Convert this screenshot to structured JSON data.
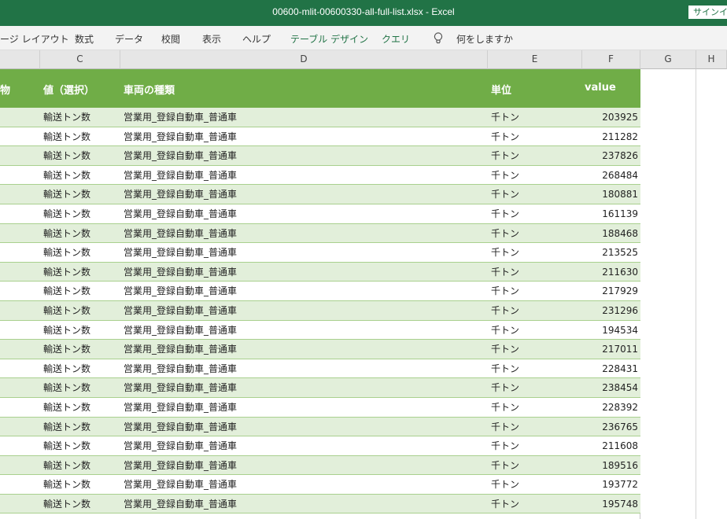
{
  "window": {
    "title": "00600-mlit-00600330-all-full-list.xlsx  -  Excel",
    "signin_label": "サインイン"
  },
  "ribbon": {
    "tabs": [
      {
        "label": "ージ レイアウト"
      },
      {
        "label": "数式"
      },
      {
        "label": "データ"
      },
      {
        "label": "校閲"
      },
      {
        "label": "表示"
      },
      {
        "label": "ヘルプ"
      },
      {
        "label": "テーブル デザイン"
      },
      {
        "label": "クエリ"
      }
    ],
    "tell_me": "何をしますか",
    "tell_me_icon": "lightbulb-icon"
  },
  "columns": [
    "C",
    "D",
    "E",
    "F",
    "G",
    "H"
  ],
  "table": {
    "headers": {
      "b": "物",
      "c": "値（選択）",
      "d": "車両の種類",
      "e": "単位",
      "f": "value"
    },
    "rows": [
      {
        "c": "輸送トン数",
        "d": "営業用_登録自動車_普通車",
        "e": "千トン",
        "f": "203925"
      },
      {
        "c": "輸送トン数",
        "d": "営業用_登録自動車_普通車",
        "e": "千トン",
        "f": "211282"
      },
      {
        "c": "輸送トン数",
        "d": "営業用_登録自動車_普通車",
        "e": "千トン",
        "f": "237826"
      },
      {
        "c": "輸送トン数",
        "d": "営業用_登録自動車_普通車",
        "e": "千トン",
        "f": "268484"
      },
      {
        "c": "輸送トン数",
        "d": "営業用_登録自動車_普通車",
        "e": "千トン",
        "f": "180881"
      },
      {
        "c": "輸送トン数",
        "d": "営業用_登録自動車_普通車",
        "e": "千トン",
        "f": "161139"
      },
      {
        "c": "輸送トン数",
        "d": "営業用_登録自動車_普通車",
        "e": "千トン",
        "f": "188468"
      },
      {
        "c": "輸送トン数",
        "d": "営業用_登録自動車_普通車",
        "e": "千トン",
        "f": "213525"
      },
      {
        "c": "輸送トン数",
        "d": "営業用_登録自動車_普通車",
        "e": "千トン",
        "f": "211630"
      },
      {
        "c": "輸送トン数",
        "d": "営業用_登録自動車_普通車",
        "e": "千トン",
        "f": "217929"
      },
      {
        "c": "輸送トン数",
        "d": "営業用_登録自動車_普通車",
        "e": "千トン",
        "f": "231296"
      },
      {
        "c": "輸送トン数",
        "d": "営業用_登録自動車_普通車",
        "e": "千トン",
        "f": "194534"
      },
      {
        "c": "輸送トン数",
        "d": "営業用_登録自動車_普通車",
        "e": "千トン",
        "f": "217011"
      },
      {
        "c": "輸送トン数",
        "d": "営業用_登録自動車_普通車",
        "e": "千トン",
        "f": "228431"
      },
      {
        "c": "輸送トン数",
        "d": "営業用_登録自動車_普通車",
        "e": "千トン",
        "f": "238454"
      },
      {
        "c": "輸送トン数",
        "d": "営業用_登録自動車_普通車",
        "e": "千トン",
        "f": "228392"
      },
      {
        "c": "輸送トン数",
        "d": "営業用_登録自動車_普通車",
        "e": "千トン",
        "f": "236765"
      },
      {
        "c": "輸送トン数",
        "d": "営業用_登録自動車_普通車",
        "e": "千トン",
        "f": "211608"
      },
      {
        "c": "輸送トン数",
        "d": "営業用_登録自動車_普通車",
        "e": "千トン",
        "f": "189516"
      },
      {
        "c": "輸送トン数",
        "d": "営業用_登録自動車_普通車",
        "e": "千トン",
        "f": "193772"
      },
      {
        "c": "輸送トン数",
        "d": "営業用_登録自動車_普通車",
        "e": "千トン",
        "f": "195748"
      }
    ]
  },
  "colors": {
    "title_bar": "#217346",
    "table_header": "#70ad47",
    "band_light": "#e2efda"
  }
}
